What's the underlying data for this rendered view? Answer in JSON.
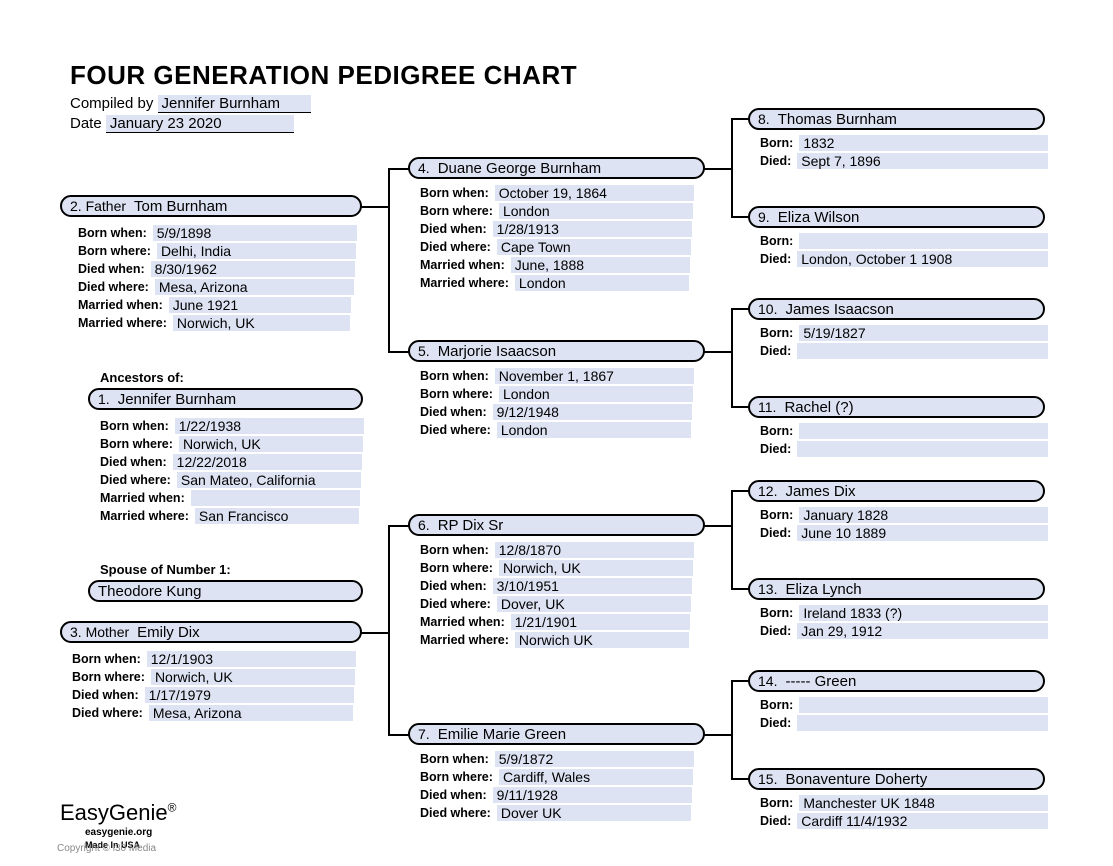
{
  "title": "FOUR GENERATION PEDIGREE CHART",
  "compiled_by_label": "Compiled by",
  "compiled_by": "Jennifer Burnham",
  "date_label": "Date",
  "date": "January 23 2020",
  "ancestors_of_label": "Ancestors of:",
  "spouse_label": "Spouse of Number 1:",
  "spouse_name": "Theodore Kung",
  "brand": "EasyGenie",
  "brand_url": "easygenie.org",
  "brand_made": "Made In USA",
  "copyright": "Copyright © i30 Media",
  "labels": {
    "born_when": "Born when:",
    "born_where": "Born where:",
    "died_when": "Died when:",
    "died_where": "Died where:",
    "married_when": "Married when:",
    "married_where": "Married where:",
    "born": "Born:",
    "died": "Died:",
    "father": "2. Father",
    "mother": "3. Mother"
  },
  "p1": {
    "num": "1.",
    "name": "Jennifer Burnham",
    "born_when": "1/22/1938",
    "born_where": "Norwich, UK",
    "died_when": "12/22/2018",
    "died_where": "San Mateo, California",
    "married_when": "",
    "married_where": "San Francisco"
  },
  "p2": {
    "name": "Tom Burnham",
    "born_when": "5/9/1898",
    "born_where": "Delhi, India",
    "died_when": "8/30/1962",
    "died_where": "Mesa, Arizona",
    "married_when": "June 1921",
    "married_where": "Norwich, UK"
  },
  "p3": {
    "name": "Emily Dix",
    "born_when": "12/1/1903",
    "born_where": "Norwich, UK",
    "died_when": "1/17/1979",
    "died_where": "Mesa, Arizona"
  },
  "p4": {
    "num": "4.",
    "name": "Duane George Burnham",
    "born_when": "October 19, 1864",
    "born_where": "London",
    "died_when": "1/28/1913",
    "died_where": "Cape Town",
    "married_when": "June, 1888",
    "married_where": "London"
  },
  "p5": {
    "num": "5.",
    "name": "Marjorie Isaacson",
    "born_when": "November 1, 1867",
    "born_where": "London",
    "died_when": "9/12/1948",
    "died_where": "London"
  },
  "p6": {
    "num": "6.",
    "name": "RP Dix Sr",
    "born_when": "12/8/1870",
    "born_where": "Norwich, UK",
    "died_when": "3/10/1951",
    "died_where": "Dover, UK",
    "married_when": "1/21/1901",
    "married_where": "Norwich UK"
  },
  "p7": {
    "num": "7.",
    "name": "Emilie Marie Green",
    "born_when": "5/9/1872",
    "born_where": "Cardiff, Wales",
    "died_when": "9/11/1928",
    "died_where": "Dover UK"
  },
  "p8": {
    "num": "8.",
    "name": "Thomas Burnham",
    "born": "1832",
    "died": "Sept 7, 1896"
  },
  "p9": {
    "num": "9.",
    "name": "Eliza Wilson",
    "born": "",
    "died": "London, October 1 1908"
  },
  "p10": {
    "num": "10.",
    "name": "James Isaacson",
    "born": "5/19/1827",
    "died": ""
  },
  "p11": {
    "num": "11.",
    "name": "Rachel (?)",
    "born": "",
    "died": ""
  },
  "p12": {
    "num": "12.",
    "name": "James Dix",
    "born": "January 1828",
    "died": "June 10 1889"
  },
  "p13": {
    "num": "13.",
    "name": "Eliza Lynch",
    "born": "Ireland 1833 (?)",
    "died": "Jan 29, 1912"
  },
  "p14": {
    "num": "14.",
    "name": "----- Green",
    "born": "",
    "died": ""
  },
  "p15": {
    "num": "15.",
    "name": "Bonaventure Doherty",
    "born": "Manchester UK 1848",
    "died": "Cardiff 11/4/1932"
  }
}
